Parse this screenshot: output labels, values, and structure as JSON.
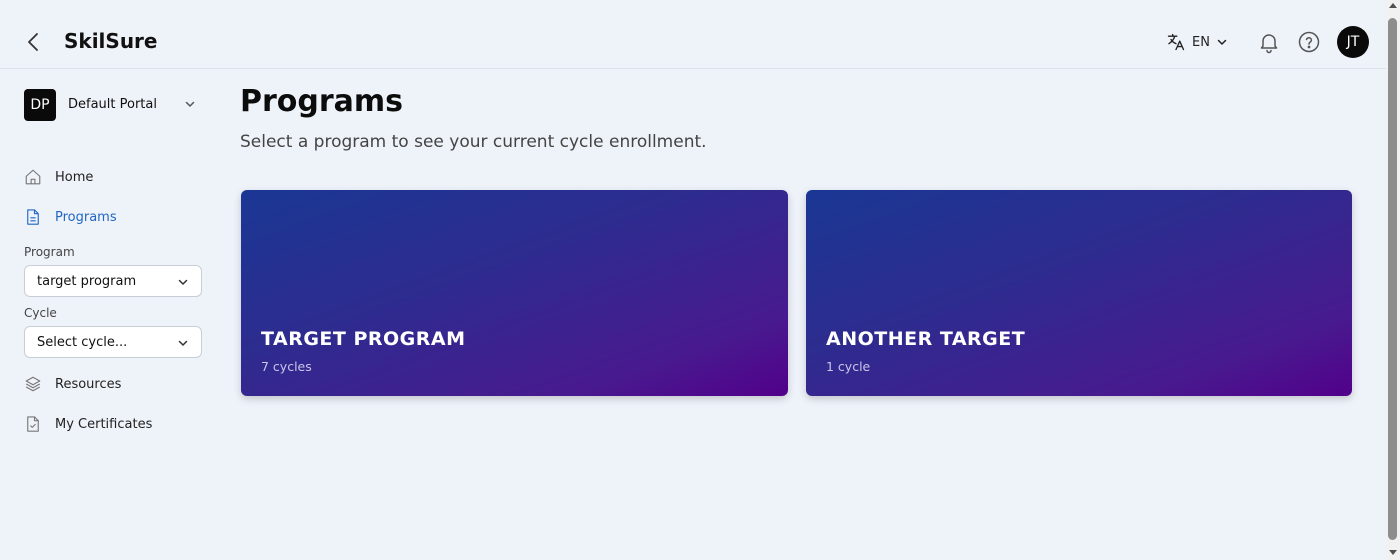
{
  "header": {
    "brand": "SkilSure",
    "language": "EN",
    "user_initials": "JT"
  },
  "sidebar": {
    "portal": {
      "initials": "DP",
      "name": "Default Portal"
    },
    "items": [
      {
        "label": "Home",
        "icon": "home-icon"
      },
      {
        "label": "Programs",
        "icon": "document-icon",
        "active": true
      },
      {
        "label": "Resources",
        "icon": "layers-icon"
      },
      {
        "label": "My Certificates",
        "icon": "certificate-icon"
      }
    ],
    "program_label": "Program",
    "program_value": "target program",
    "cycle_label": "Cycle",
    "cycle_value": "Select cycle..."
  },
  "main": {
    "title": "Programs",
    "subtitle": "Select a program to see your current cycle enrollment.",
    "programs": [
      {
        "name": "TARGET PROGRAM",
        "meta": "7 cycles"
      },
      {
        "name": "ANOTHER TARGET",
        "meta": "1 cycle"
      }
    ]
  },
  "colors": {
    "accent": "#2166c5",
    "background": "#eef2f9",
    "card_gradient_start": "#1a3794",
    "card_gradient_end": "#52008a"
  }
}
